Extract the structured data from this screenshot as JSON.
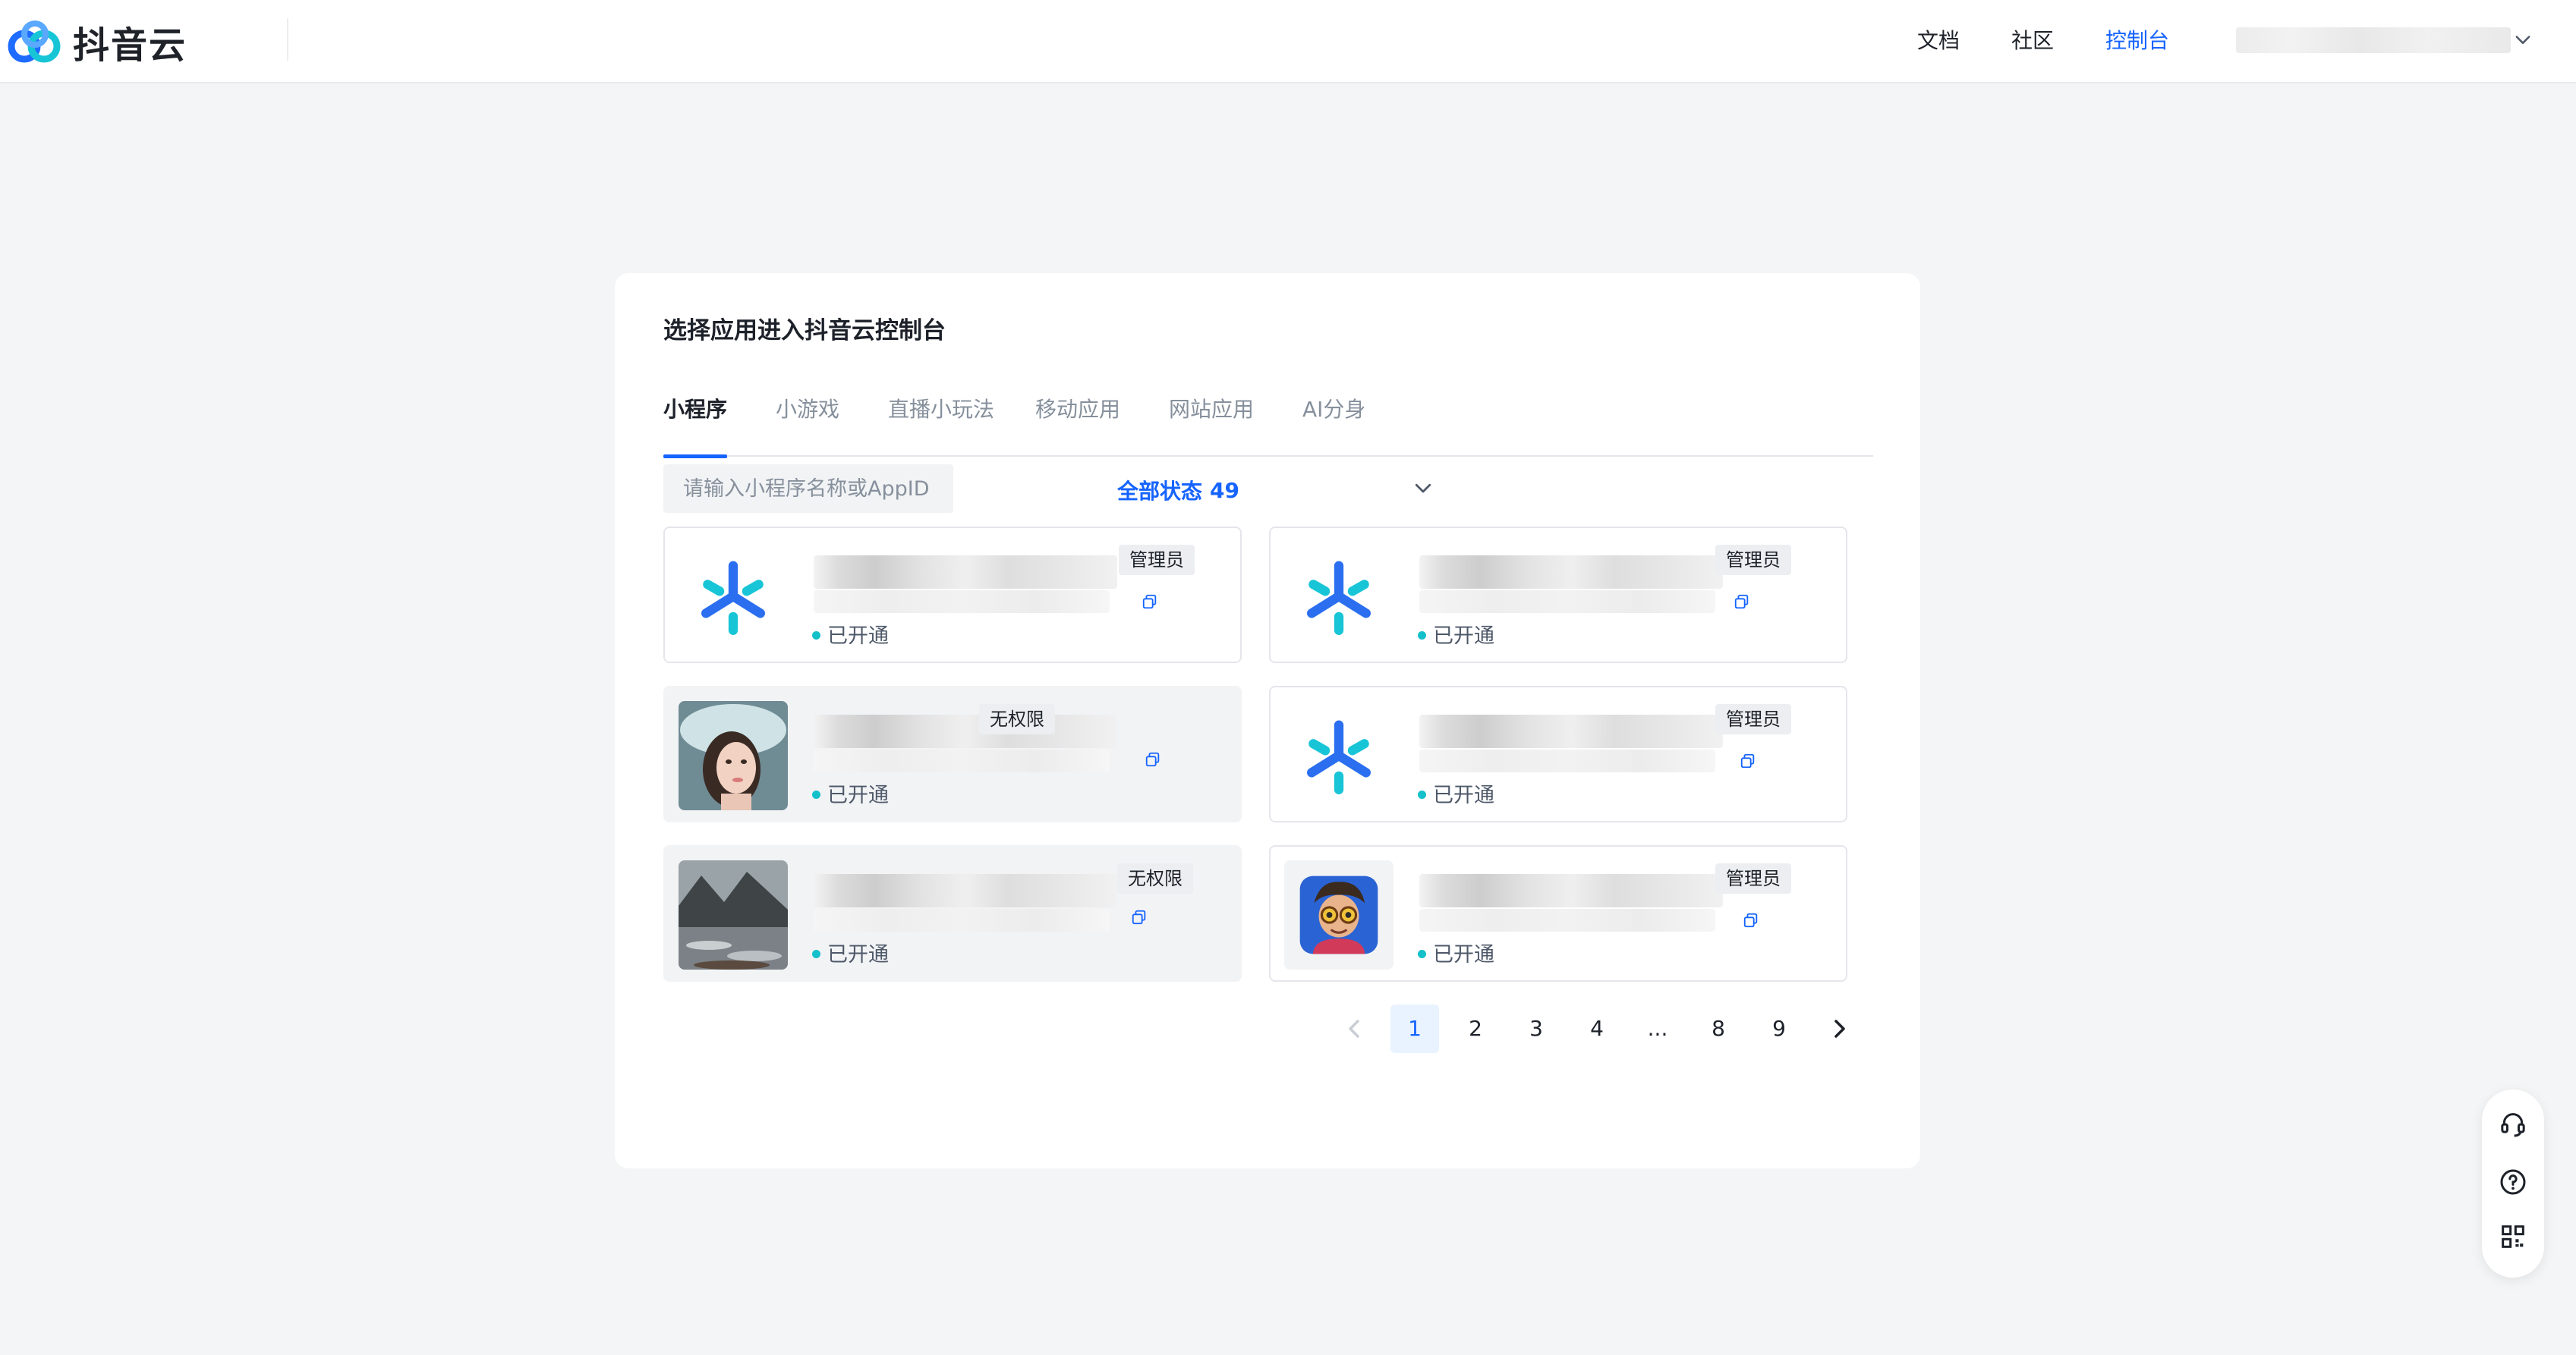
{
  "header": {
    "brand": "抖音云",
    "nav": [
      {
        "label": "文档",
        "active": false
      },
      {
        "label": "社区",
        "active": false
      },
      {
        "label": "控制台",
        "active": true
      }
    ],
    "account_chevron_icon": "chevron-down-icon"
  },
  "panel": {
    "title": "选择应用进入抖音云控制台",
    "tabs": [
      {
        "label": "小程序",
        "active": true
      },
      {
        "label": "小游戏",
        "active": false
      },
      {
        "label": "直播小玩法",
        "active": false
      },
      {
        "label": "移动应用",
        "active": false
      },
      {
        "label": "网站应用",
        "active": false
      },
      {
        "label": "AI分身",
        "active": false
      }
    ],
    "search_placeholder": "请输入小程序名称或AppID",
    "filter_label": "全部状态",
    "filter_count": "49",
    "cards": [
      {
        "role": "管理员",
        "status": "已开通",
        "thumb": "snowflake-logo-icon",
        "disabled": false
      },
      {
        "role": "管理员",
        "status": "已开通",
        "thumb": "snowflake-logo-icon",
        "disabled": false
      },
      {
        "role": "无权限",
        "status": "已开通",
        "thumb": "portrait-avatar",
        "disabled": true
      },
      {
        "role": "管理员",
        "status": "已开通",
        "thumb": "snowflake-logo-icon",
        "disabled": false
      },
      {
        "role": "无权限",
        "status": "已开通",
        "thumb": "landscape-avatar",
        "disabled": true
      },
      {
        "role": "管理员",
        "status": "已开通",
        "thumb": "cartoon-avatar",
        "disabled": false
      }
    ],
    "pagination": {
      "pages": [
        "1",
        "2",
        "3",
        "4",
        "...",
        "8",
        "9"
      ],
      "current": "1"
    }
  },
  "colors": {
    "accent": "#1664ff",
    "status_dot": "#14c0c9",
    "logo_blue": "#1e6bff",
    "logo_cyan": "#18c5d6"
  },
  "float_tools": [
    "headset-icon",
    "help-icon",
    "qrcode-icon"
  ]
}
